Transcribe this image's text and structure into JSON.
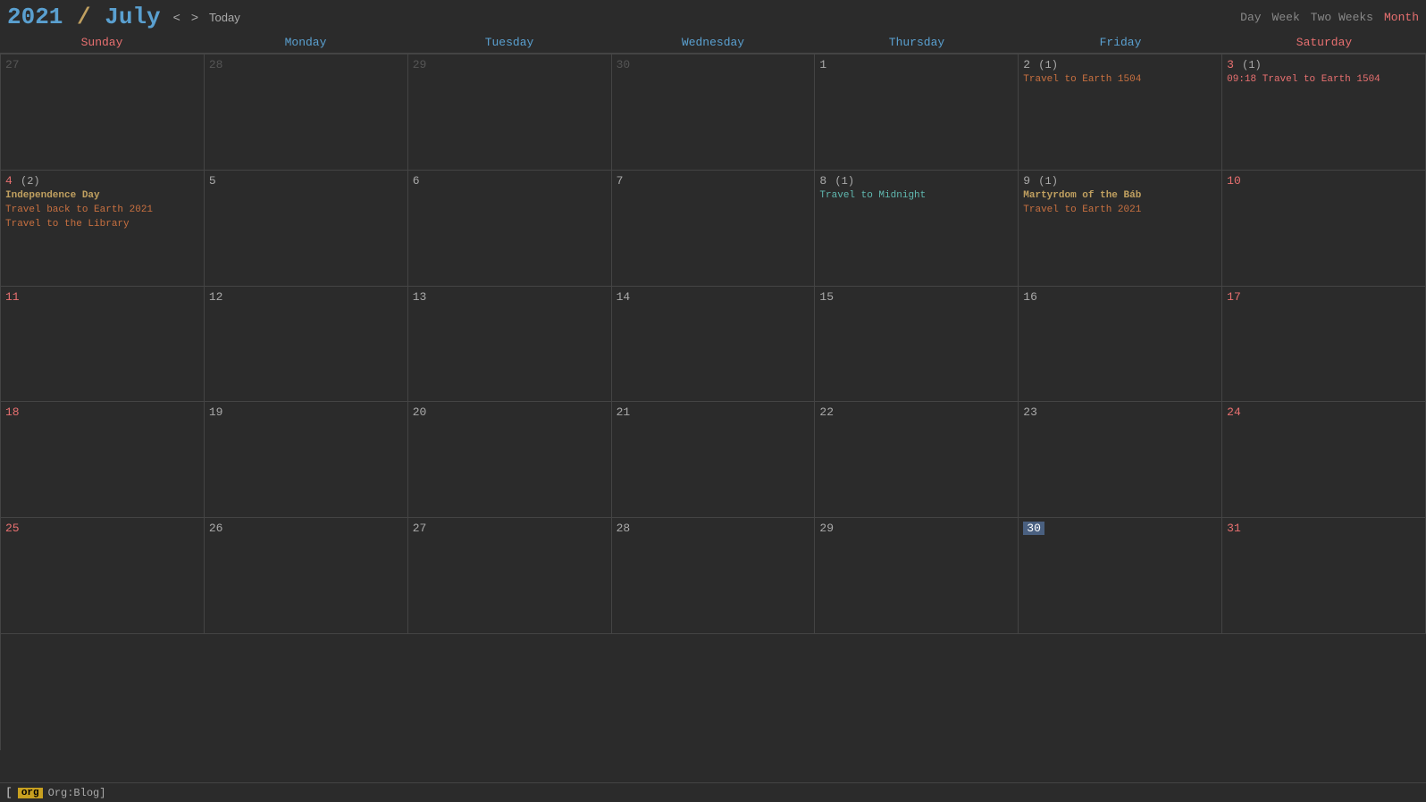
{
  "header": {
    "year": "2021",
    "month": "July",
    "prev_label": "<",
    "next_label": ">",
    "today_label": "Today",
    "views": [
      "Day",
      "Week",
      "Two Weeks",
      "Month"
    ],
    "active_view": "Month"
  },
  "day_headers": [
    {
      "label": "Sunday",
      "type": "weekend"
    },
    {
      "label": "Monday",
      "type": "weekday"
    },
    {
      "label": "Tuesday",
      "type": "weekday"
    },
    {
      "label": "Wednesday",
      "type": "weekday"
    },
    {
      "label": "Thursday",
      "type": "weekday"
    },
    {
      "label": "Friday",
      "type": "weekday"
    },
    {
      "label": "Saturday",
      "type": "weekend"
    }
  ],
  "weeks": [
    [
      {
        "day": 27,
        "other": true
      },
      {
        "day": 28,
        "other": true
      },
      {
        "day": 29,
        "other": true
      },
      {
        "day": 30,
        "other": true
      },
      {
        "day": 1
      },
      {
        "day": 2,
        "count": 1,
        "events": [
          {
            "text": "Travel to Earth 1504",
            "type": "orange"
          }
        ]
      },
      {
        "day": 3,
        "weekend": true,
        "count": 1,
        "events": [
          {
            "text": "09:18 Travel to Earth 1504",
            "type": "time-event"
          }
        ]
      }
    ],
    [
      {
        "day": 4,
        "weekend": true,
        "count": 2,
        "events": [
          {
            "text": "Independence Day",
            "type": "holiday"
          },
          {
            "text": "Travel back to Earth 2021",
            "type": "orange"
          },
          {
            "text": "Travel to the Library",
            "type": "orange"
          }
        ]
      },
      {
        "day": 5
      },
      {
        "day": 6
      },
      {
        "day": 7
      },
      {
        "day": 8,
        "count": 1,
        "events": [
          {
            "text": "Travel to Midnight",
            "type": "cyan"
          }
        ]
      },
      {
        "day": 9,
        "count": 1,
        "events": [
          {
            "text": "Martyrdom of the Báb",
            "type": "holiday"
          },
          {
            "text": "Travel to Earth 2021",
            "type": "orange"
          }
        ]
      },
      {
        "day": 10,
        "weekend": true
      }
    ],
    [
      {
        "day": 11,
        "weekend": true
      },
      {
        "day": 12
      },
      {
        "day": 13
      },
      {
        "day": 14
      },
      {
        "day": 15
      },
      {
        "day": 16
      },
      {
        "day": 17,
        "weekend": true
      }
    ],
    [
      {
        "day": 18,
        "weekend": true
      },
      {
        "day": 19
      },
      {
        "day": 20
      },
      {
        "day": 21
      },
      {
        "day": 22
      },
      {
        "day": 23
      },
      {
        "day": 24,
        "weekend": true
      }
    ],
    [
      {
        "day": 25,
        "weekend": true
      },
      {
        "day": 26
      },
      {
        "day": 27
      },
      {
        "day": 28
      },
      {
        "day": 29
      },
      {
        "day": 30,
        "today": true
      },
      {
        "day": 31,
        "weekend": true
      }
    ]
  ],
  "statusbar": {
    "tag": "org",
    "label": "Org:Blog]"
  }
}
